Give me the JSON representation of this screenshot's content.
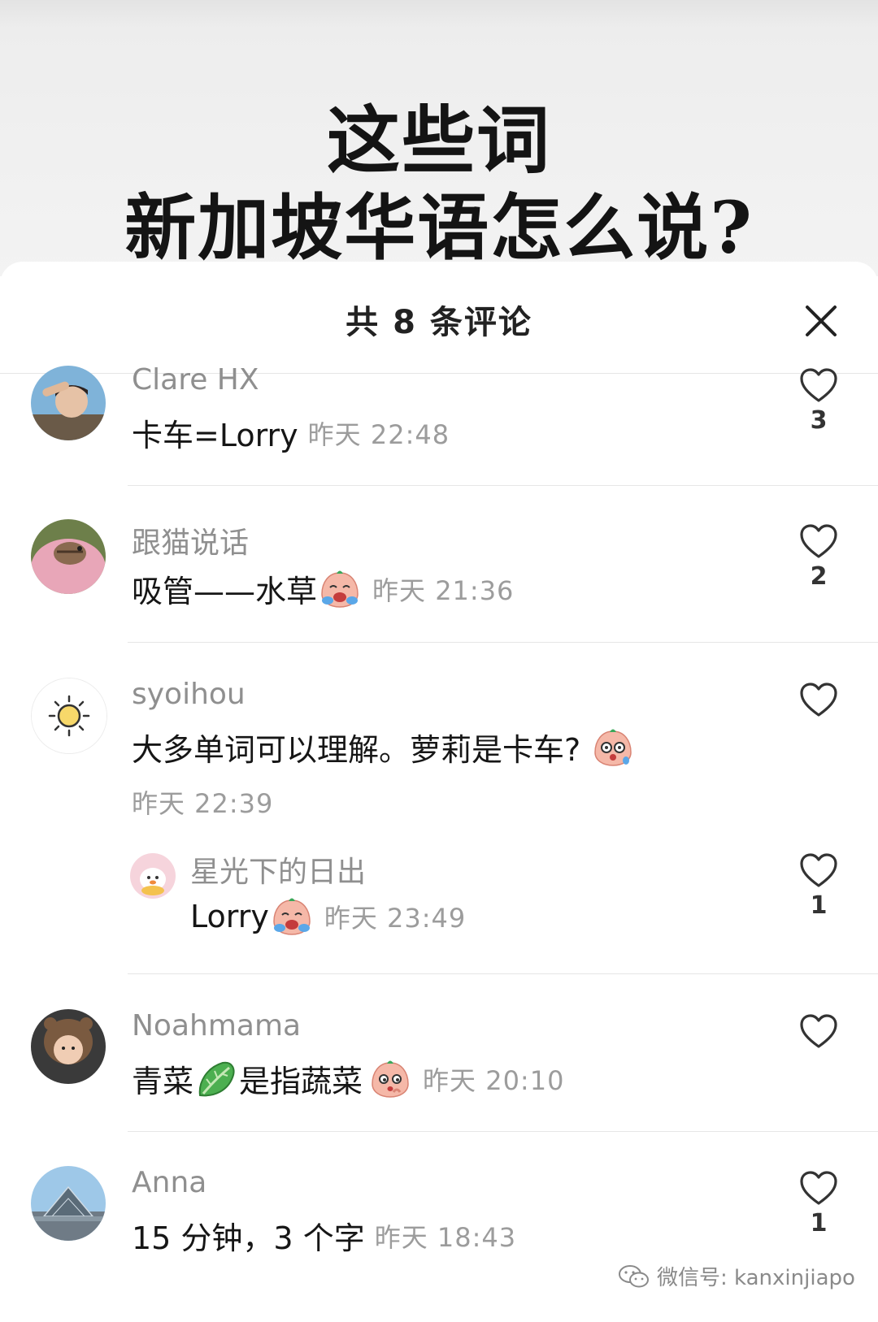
{
  "cover": {
    "line1": "这些词",
    "line2": "新加坡华语怎么说?"
  },
  "header": {
    "title": "共 8 条评论",
    "close_icon": "close-icon"
  },
  "comments": [
    {
      "user": "Clare HX",
      "text": "卡车=Lorry",
      "time": "昨天 22:48",
      "likes": "3"
    },
    {
      "user": "跟猫说话",
      "text_before": "吸管——水草",
      "emoji": "crying-laugh-emoji",
      "time": "昨天 21:36",
      "likes": "2"
    },
    {
      "user": "syoihou",
      "text": "大多单词可以理解。萝莉是卡车?",
      "emoji": "shocked-emoji",
      "time": "昨天 22:39",
      "reply": {
        "user": "星光下的日出",
        "text": "Lorry",
        "emoji": "crying-laugh-emoji",
        "time": "昨天 23:49",
        "likes": "1"
      }
    },
    {
      "user": "Noahmama",
      "text_a": "青菜",
      "emoji_a": "lettuce-emoji",
      "text_b": "是指蔬菜",
      "emoji_b": "thinking-emoji",
      "time": "昨天 20:10"
    },
    {
      "user": "Anna",
      "text": "15 分钟，3 个字",
      "time": "昨天 18:43",
      "likes": "1"
    }
  ],
  "watermark": {
    "text": "微信号: kanxinjiapo",
    "icon": "wechat-icon"
  },
  "colors": {
    "username": "#8f8f8f",
    "time": "#9c9c9c",
    "text": "#161616"
  }
}
